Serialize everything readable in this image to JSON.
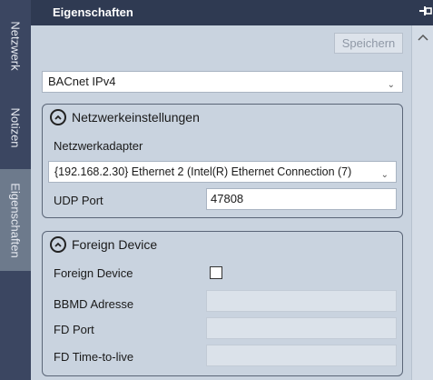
{
  "side_tabs": [
    "Netzwerk",
    "Notizen",
    "Eigenschaften"
  ],
  "header": {
    "title": "Eigenschaften"
  },
  "toolbar": {
    "save_label": "Speichern"
  },
  "protocol": {
    "selected": "BACnet IPv4"
  },
  "network_group": {
    "title": "Netzwerkeinstellungen",
    "adapter_label": "Netzwerkadapter",
    "adapter_value": "{192.168.2.30} Ethernet 2 (Intel(R) Ethernet Connection (7)",
    "udp_label": "UDP Port",
    "udp_value": "47808"
  },
  "foreign_group": {
    "title": "Foreign Device",
    "fd_label": "Foreign Device",
    "fd_checked": false,
    "bbmd_label": "BBMD Adresse",
    "bbmd_value": "",
    "port_label": "FD Port",
    "port_value": "",
    "ttl_label": "FD Time-to-live",
    "ttl_value": ""
  }
}
